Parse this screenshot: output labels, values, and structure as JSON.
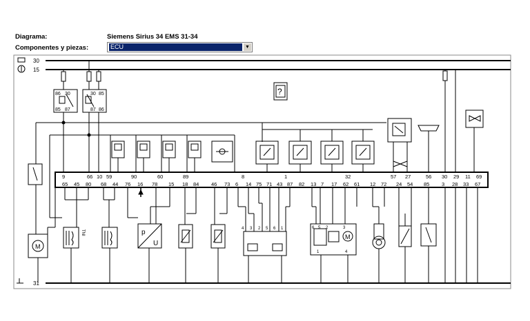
{
  "header": {
    "diagram_label": "Diagrama:",
    "diagram_value": "Siemens Sirius 34 EMS 31-34",
    "components_label": "Componentes y piezas:",
    "components_value": "ECU"
  },
  "diagram": {
    "rail_labels": [
      "30",
      "15",
      "31"
    ],
    "relay1_pins": [
      "86",
      "30",
      "85",
      "87"
    ],
    "relay2_pins": [
      "30",
      "85",
      "87",
      "86"
    ],
    "unknown_symbol": "?",
    "ecu_top_pins": [
      "9",
      "66",
      "10",
      "59",
      "90",
      "60",
      "89",
      "8",
      "1",
      "32",
      "57",
      "27",
      "56",
      "30",
      "29",
      "11",
      "69"
    ],
    "ecu_bottom_pins": [
      "65",
      "45",
      "80",
      "68",
      "44",
      "76",
      "16",
      "78",
      "15",
      "18",
      "84",
      "46",
      "73",
      "6",
      "14",
      "75",
      "71",
      "43",
      "87",
      "82",
      "13",
      "7",
      "17",
      "62",
      "61",
      "12",
      "72",
      "24",
      "54",
      "85",
      "3",
      "28",
      "33",
      "67"
    ],
    "injector_pins": [
      "4",
      "3",
      "2",
      "5",
      "6",
      "1"
    ],
    "idle_valve_pins": [
      "6",
      "5",
      "2",
      "3",
      "1",
      "4"
    ],
    "motor_symbol": "M",
    "pressure_sensor_symbols": [
      "p",
      "U"
    ],
    "temp_marker": "TNI"
  }
}
